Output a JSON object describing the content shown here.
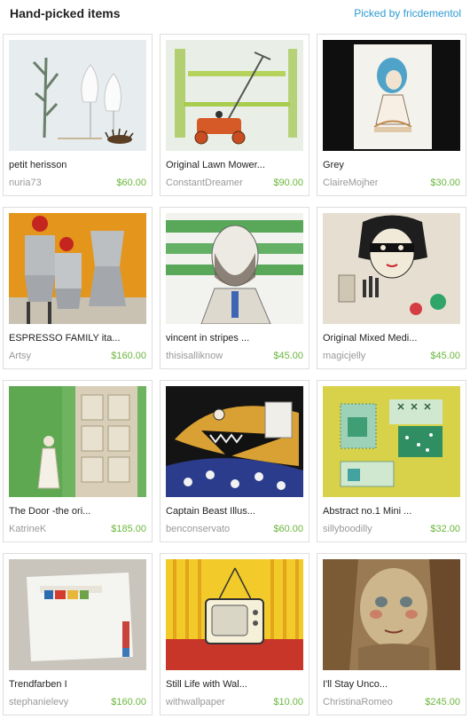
{
  "header": {
    "title": "Hand-picked items",
    "picked_by": "Picked by fricdementol"
  },
  "items": [
    {
      "title": "petit herisson",
      "shop": "nuria73",
      "price": "$60.00"
    },
    {
      "title": "Original Lawn Mower...",
      "shop": "ConstantDreamer",
      "price": "$90.00"
    },
    {
      "title": "Grey",
      "shop": "ClaireMojher",
      "price": "$30.00"
    },
    {
      "title": "ESPRESSO FAMILY ita...",
      "shop": "Artsy",
      "price": "$160.00"
    },
    {
      "title": "vincent in stripes ...",
      "shop": "thisisalliknow",
      "price": "$45.00"
    },
    {
      "title": "Original Mixed Medi...",
      "shop": "magicjelly",
      "price": "$45.00"
    },
    {
      "title": "The Door -the ori...",
      "shop": "KatrineK",
      "price": "$185.00"
    },
    {
      "title": "Captain Beast Illus...",
      "shop": "benconservato",
      "price": "$60.00"
    },
    {
      "title": "Abstract no.1 Mini ...",
      "shop": "sillyboodilly",
      "price": "$32.00"
    },
    {
      "title": "Trendfarben I",
      "shop": "stephanielevy",
      "price": "$160.00"
    },
    {
      "title": "Still Life with Wal...",
      "shop": "withwallpaper",
      "price": "$10.00"
    },
    {
      "title": "I'll Stay Unco...",
      "shop": "ChristinaRomeo",
      "price": "$245.00"
    }
  ]
}
